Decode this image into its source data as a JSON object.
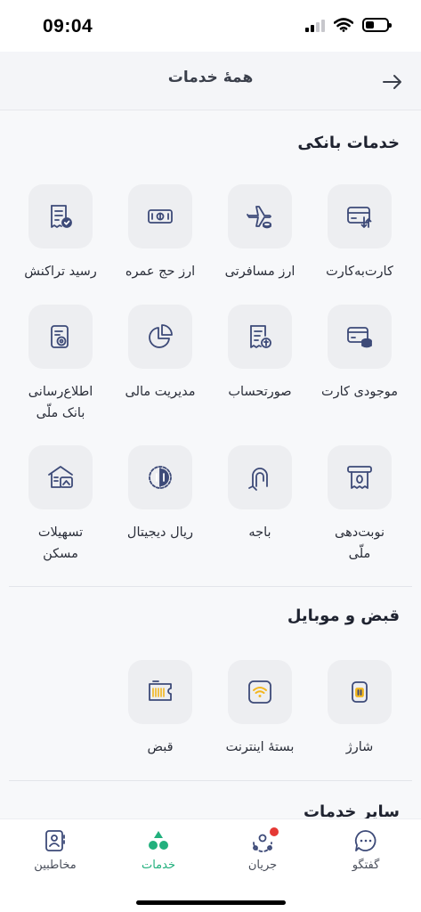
{
  "status_bar": {
    "time": "09:04"
  },
  "header": {
    "title": "همهٔ خدمات"
  },
  "sections": {
    "banking": {
      "title": "خدمات بانکی",
      "items": [
        {
          "label": "کارت‌به‌کارت",
          "icon": "card-transfer-icon"
        },
        {
          "label": "ارز مسافرتی",
          "icon": "airplane-icon"
        },
        {
          "label": "ارز حج عمره",
          "icon": "banknote-icon"
        },
        {
          "label": "رسید تراکنش",
          "icon": "receipt-check-icon"
        },
        {
          "label": "موجودی کارت",
          "icon": "card-balance-icon"
        },
        {
          "label": "صورتحساب",
          "icon": "statement-icon"
        },
        {
          "label": "مدیریت مالی",
          "icon": "pie-chart-icon"
        },
        {
          "label": "اطلاع‌رسانی\nبانک ملّی",
          "icon": "notification-doc-icon"
        },
        {
          "label": "نوبت‌دهی\nملّی",
          "icon": "ticket-queue-icon"
        },
        {
          "label": "باجه",
          "icon": "bell-kiosk-icon"
        },
        {
          "label": "ریال دیجیتال",
          "icon": "digital-rial-icon"
        },
        {
          "label": "تسهیلات\nمسکن",
          "icon": "house-loan-icon"
        }
      ]
    },
    "bills": {
      "title": "قبض و موبایل",
      "items": [
        {
          "label": "شارژ",
          "icon": "sim-card-icon"
        },
        {
          "label": "بستهٔ اینترنت",
          "icon": "wifi-icon"
        },
        {
          "label": "قبض",
          "icon": "bill-icon"
        }
      ]
    },
    "other": {
      "title": "سایر خدمات"
    }
  },
  "bottom_nav": {
    "items": [
      {
        "label": "گفتگو",
        "icon": "chat-icon"
      },
      {
        "label": "جریان",
        "icon": "flow-icon"
      },
      {
        "label": "خدمات",
        "icon": "services-icon"
      },
      {
        "label": "مخاطبین",
        "icon": "contacts-icon"
      }
    ],
    "active": "خدمات"
  },
  "colors": {
    "icon_blue": "#3d4a78",
    "accent_green": "#22b07d",
    "accent_yellow": "#f2b61d",
    "badge_red": "#e53935"
  }
}
